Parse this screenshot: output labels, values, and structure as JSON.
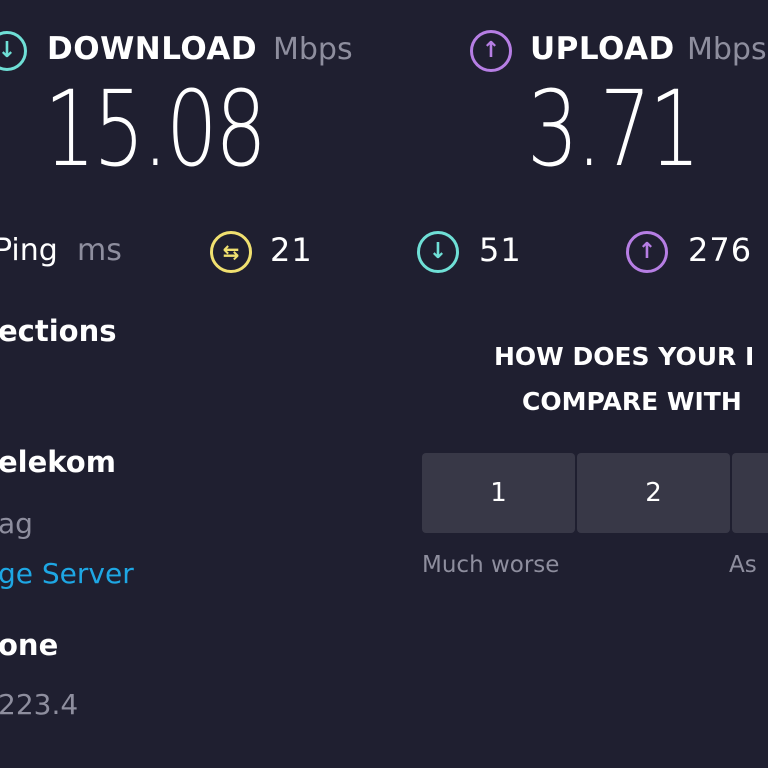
{
  "colors": {
    "background": "#1f1f30",
    "download_accent": "#6fdfd6",
    "upload_accent": "#b67ee4",
    "ping_accent": "#f0e070",
    "link": "#1ea7e4",
    "muted": "#8e8e9e",
    "rating_button": "#383847"
  },
  "download": {
    "label": "DOWNLOAD",
    "unit": "Mbps",
    "value": "15.08",
    "icon": "arrow-down-circle-icon"
  },
  "upload": {
    "label": "UPLOAD",
    "unit": "Mbps",
    "value": "3.71",
    "icon": "arrow-up-circle-icon"
  },
  "ping": {
    "label": "Ping",
    "unit": "ms",
    "idle": {
      "icon": "jitter-circle-icon",
      "value": "21"
    },
    "download": {
      "icon": "arrow-down-circle-icon",
      "value": "51"
    },
    "upload": {
      "icon": "arrow-up-circle-icon",
      "value": "276"
    }
  },
  "sidebar": {
    "connections_title": "ections",
    "isp_name": "elekom",
    "isp_location": "ag",
    "change_server_link": "ge Server",
    "server_name": "one",
    "server_ip": "223.4"
  },
  "survey": {
    "question_line1": "HOW DOES YOUR I",
    "question_line2": "COMPARE WITH",
    "options": [
      "1",
      "2",
      ""
    ],
    "label_low": "Much worse",
    "label_mid": "As"
  }
}
